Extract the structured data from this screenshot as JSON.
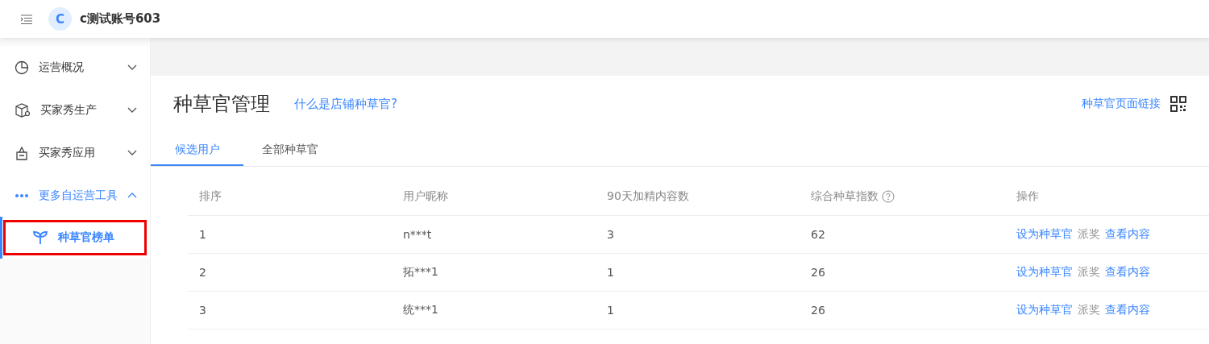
{
  "header": {
    "avatar": "C",
    "account": "c测试账号603"
  },
  "sidebar": {
    "items": [
      {
        "label": "运营概况",
        "expanded": false,
        "selected": false
      },
      {
        "label": "买家秀生产",
        "expanded": false,
        "selected": false
      },
      {
        "label": "买家秀应用",
        "expanded": false,
        "selected": false
      },
      {
        "label": "更多自运营工具",
        "expanded": true,
        "selected": true,
        "children": [
          {
            "label": "种草官榜单",
            "selected": true
          }
        ]
      }
    ]
  },
  "page": {
    "title": "种草官管理",
    "help_link": "什么是店铺种草官?",
    "page_link": "种草官页面链接"
  },
  "tabs": [
    {
      "label": "候选用户",
      "selected": true
    },
    {
      "label": "全部种草官",
      "selected": false
    }
  ],
  "table": {
    "columns": [
      "排序",
      "用户昵称",
      "90天加精内容数",
      "综合种草指数",
      "操作"
    ],
    "rows": [
      {
        "cells": [
          "1",
          "n***t",
          "3",
          "62"
        ],
        "actions": [
          {
            "label": "设为种草官",
            "disabled": false
          },
          {
            "label": "派奖",
            "disabled": true
          },
          {
            "label": "查看内容",
            "disabled": false
          }
        ]
      },
      {
        "cells": [
          "2",
          "拓***1",
          "1",
          "26"
        ],
        "actions": [
          {
            "label": "设为种草官",
            "disabled": false
          },
          {
            "label": "派奖",
            "disabled": true
          },
          {
            "label": "查看内容",
            "disabled": false
          }
        ]
      },
      {
        "cells": [
          "3",
          "统***1",
          "1",
          "26"
        ],
        "actions": [
          {
            "label": "设为种草官",
            "disabled": false
          },
          {
            "label": "派奖",
            "disabled": true
          },
          {
            "label": "查看内容",
            "disabled": false
          }
        ]
      }
    ]
  }
}
